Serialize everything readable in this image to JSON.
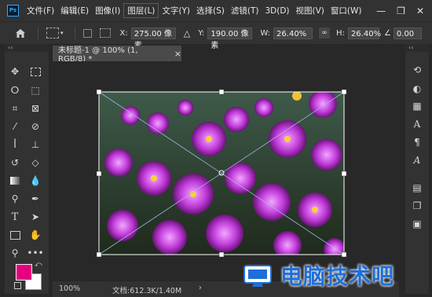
{
  "app": {
    "logo": "Ps"
  },
  "menu": {
    "items": [
      "文件(F)",
      "编辑(E)",
      "图像(I)",
      "图层(L)",
      "文字(Y)",
      "选择(S)",
      "滤镜(T)",
      "3D(D)",
      "视图(V)",
      "窗口(W)"
    ],
    "active_index": 3
  },
  "window_controls": {
    "minimize": "—",
    "maximize": "❐",
    "close": "✕"
  },
  "options": {
    "x_label": "X:",
    "x_value": "275.00 像素",
    "y_label": "Y:",
    "y_value": "190.00 像素",
    "w_label": "W:",
    "w_value": "26.40%",
    "h_label": "H:",
    "h_value": "26.40%",
    "angle_value": "0.00"
  },
  "collapse_left": "‹‹",
  "collapse_right": "‹‹",
  "document": {
    "tab_title": "未标题-1 @ 100% (1, RGB/8) *",
    "close": "×"
  },
  "status": {
    "zoom": "100%",
    "doc_info": "文档:612.3K/1.40M",
    "arrow": "›"
  },
  "watermark": {
    "text": "电脑技术吧"
  },
  "colors": {
    "foreground": "#e6007e",
    "background": "#ffffff",
    "accent": "#31a8ff"
  },
  "tool_icons": [
    "move-icon",
    "marquee-icon",
    "lasso-icon",
    "object-select-icon",
    "crop-icon",
    "frame-icon",
    "eyedropper-icon",
    "healing-icon",
    "brush-icon",
    "stamp-icon",
    "history-brush-icon",
    "eraser-icon",
    "gradient-icon",
    "blur-icon",
    "dodge-icon",
    "pen-icon",
    "type-icon",
    "path-select-icon",
    "rectangle-icon",
    "hand-icon",
    "zoom-icon",
    "more-icon"
  ],
  "panel_icons": [
    "history-icon",
    "adjust-icon",
    "swatches-icon",
    "character-icon",
    "paragraph-icon",
    "glyphs-icon",
    "channels-icon",
    "paths-icon",
    "properties-icon"
  ]
}
